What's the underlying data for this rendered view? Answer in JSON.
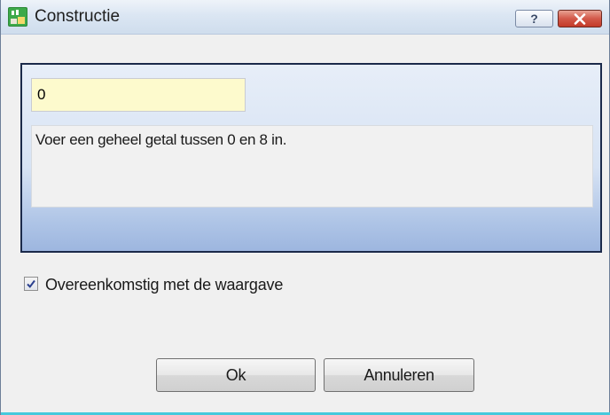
{
  "window": {
    "title": "Constructie",
    "help_label": "?",
    "colors": {
      "accent": "#47c9dc",
      "close": "#c9463a",
      "input_bg": "#fdfacd",
      "panel": "#d7e3f4"
    }
  },
  "input": {
    "value": "0"
  },
  "message": {
    "text": "Voer een geheel getal tussen 0 en 8 in."
  },
  "checkbox": {
    "label": "Overeenkomstig met de waargave",
    "checked": true
  },
  "buttons": {
    "ok_label": "Ok",
    "cancel_label": "Annuleren"
  },
  "icons": {
    "app": "app-icon",
    "help": "help-icon",
    "close": "close-icon",
    "check": "check-icon"
  }
}
